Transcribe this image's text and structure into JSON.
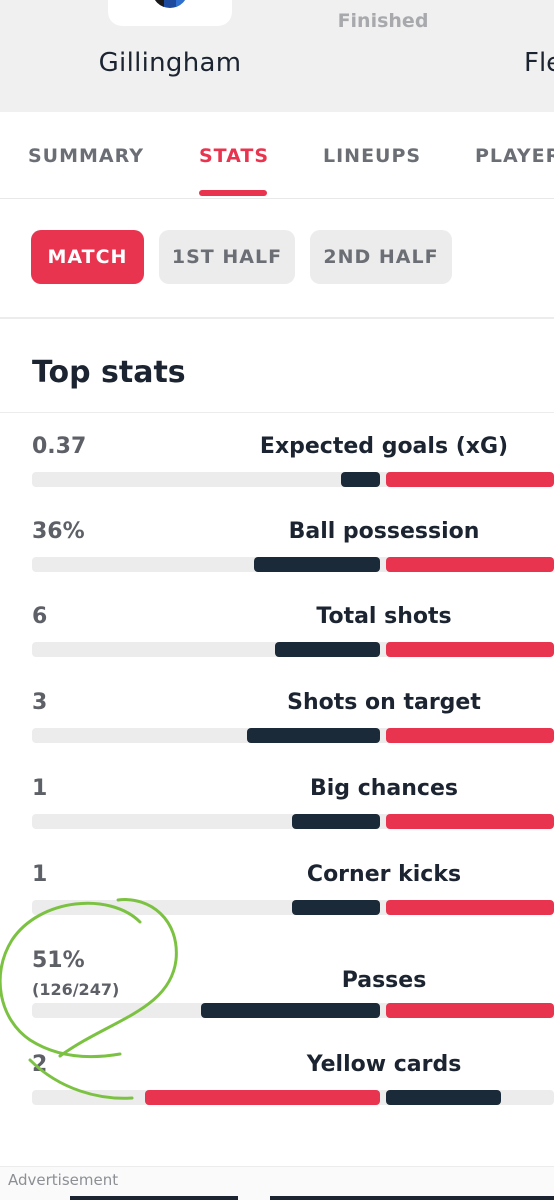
{
  "header": {
    "home_team": "Gillingham",
    "away_team_partial": "Fle",
    "status": "Finished"
  },
  "tabs": [
    {
      "label": "SUMMARY",
      "active": false
    },
    {
      "label": "STATS",
      "active": true
    },
    {
      "label": "LINEUPS",
      "active": false
    },
    {
      "label": "PLAYER",
      "active": false
    }
  ],
  "periods": [
    {
      "label": "MATCH",
      "active": true
    },
    {
      "label": "1ST HALF",
      "active": false
    },
    {
      "label": "2ND HALF",
      "active": false
    }
  ],
  "top_stats": {
    "title": "Top stats",
    "items": [
      {
        "label": "Expected goals (xG)",
        "home": "0.37",
        "home_detail": "",
        "home_share": 0.11
      },
      {
        "label": "Ball possession",
        "home": "36%",
        "home_detail": "",
        "home_share": 0.36
      },
      {
        "label": "Total shots",
        "home": "6",
        "home_detail": "",
        "home_share": 0.3
      },
      {
        "label": "Shots on target",
        "home": "3",
        "home_detail": "",
        "home_share": 0.38
      },
      {
        "label": "Big chances",
        "home": "1",
        "home_detail": "",
        "home_share": 0.25
      },
      {
        "label": "Corner kicks",
        "home": "1",
        "home_detail": "",
        "home_share": 0.25
      },
      {
        "label": "Passes",
        "home": "51%",
        "home_detail": "(126/247)",
        "home_share": 0.51
      },
      {
        "label": "Yellow cards",
        "home": "2",
        "home_detail": "",
        "home_share": 0.67
      }
    ]
  },
  "ad": {
    "label": "Advertisement"
  },
  "colors": {
    "accent": "#e8344e",
    "home_bar": "#1b2a38",
    "track": "#ececec",
    "annotation": "#7cc242"
  }
}
